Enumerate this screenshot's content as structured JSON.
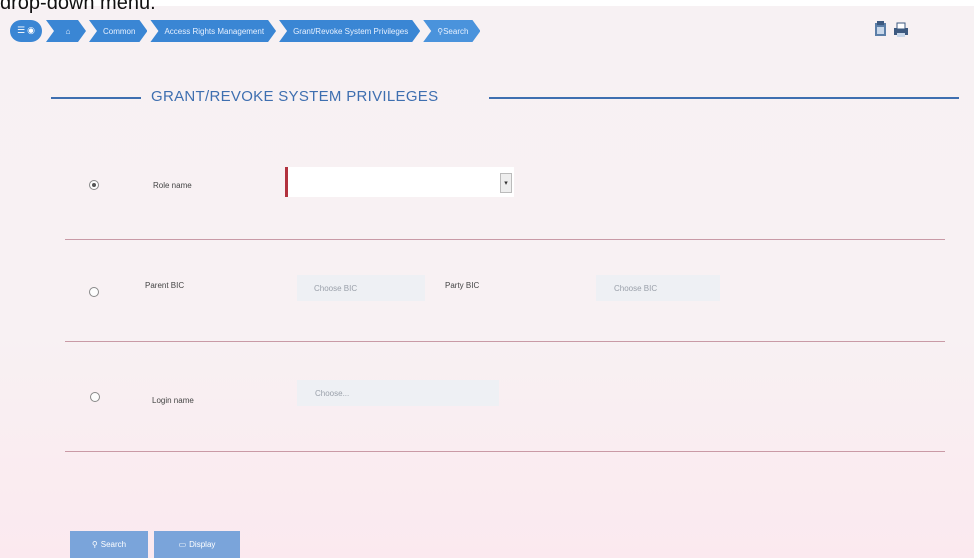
{
  "caption": "drop-down menu.",
  "breadcrumb": {
    "items": [
      "Common",
      "Access Rights Management",
      "Grant/Revoke System Privileges"
    ],
    "search_label": "Search"
  },
  "title": "GRANT/REVOKE SYSTEM PRIVILEGES",
  "role": {
    "label": "Role name",
    "selected": true
  },
  "bic": {
    "parent_label": "Parent BIC",
    "parent_placeholder": "Choose BIC",
    "party_label": "Party BIC",
    "party_placeholder": "Choose BIC",
    "selected": false
  },
  "login": {
    "label": "Login name",
    "placeholder": "Choose...",
    "selected": false
  },
  "buttons": {
    "search": "Search",
    "display": "Display"
  },
  "colors": {
    "accent": "#3a86d4",
    "title": "#3e6fb0",
    "mandatory": "#b2323e",
    "button": "#7aa4da"
  }
}
